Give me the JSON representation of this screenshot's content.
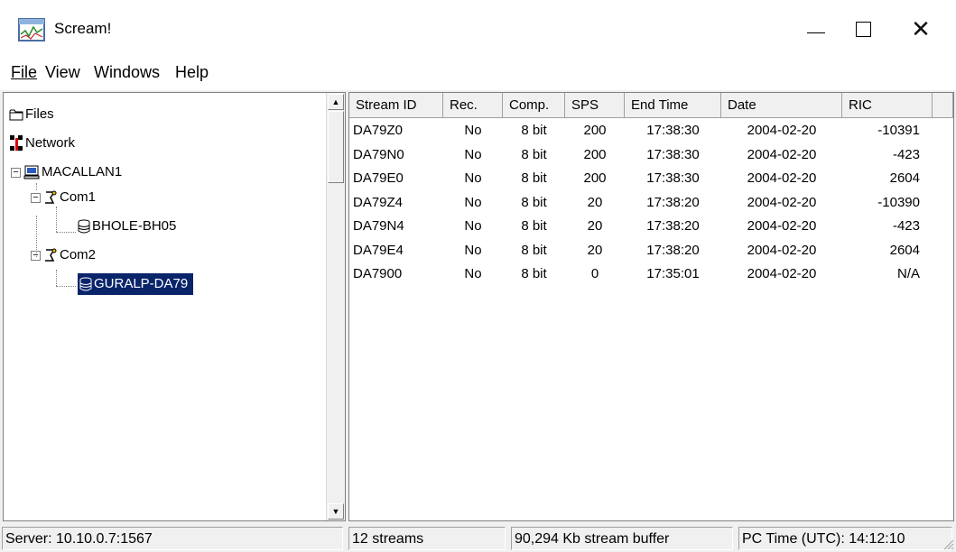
{
  "window": {
    "title": "Scream!"
  },
  "menu": [
    "File",
    "View",
    "Windows",
    "Help"
  ],
  "tree": {
    "files": "Files",
    "network": "Network",
    "server": "MACALLAN1",
    "com1": "Com1",
    "com1_device": "BHOLE-BH05",
    "com2": "Com2",
    "com2_device": "GURALP-DA79"
  },
  "columns": [
    "Stream ID",
    "Rec.",
    "Comp.",
    "SPS",
    "End Time",
    "Date",
    "RIC"
  ],
  "rows": [
    [
      "DA79Z0",
      "No",
      "8 bit",
      "200",
      "17:38:30",
      "2004-02-20",
      "-10391"
    ],
    [
      "DA79N0",
      "No",
      "8 bit",
      "200",
      "17:38:30",
      "2004-02-20",
      "-423"
    ],
    [
      "DA79E0",
      "No",
      "8 bit",
      "200",
      "17:38:30",
      "2004-02-20",
      "2604"
    ],
    [
      "DA79Z4",
      "No",
      "8 bit",
      "20",
      "17:38:20",
      "2004-02-20",
      "-10390"
    ],
    [
      "DA79N4",
      "No",
      "8 bit",
      "20",
      "17:38:20",
      "2004-02-20",
      "-423"
    ],
    [
      "DA79E4",
      "No",
      "8 bit",
      "20",
      "17:38:20",
      "2004-02-20",
      "2604"
    ],
    [
      "DA7900",
      "No",
      "8 bit",
      "0",
      "17:35:01",
      "2004-02-20",
      "N/A"
    ]
  ],
  "status": {
    "server": "Server: 10.10.0.7:1567",
    "streams": "12 streams",
    "buffer": "90,294 Kb stream buffer",
    "pctime": "PC Time (UTC):  14:12:10"
  },
  "icons": {
    "app": "scream-app-icon",
    "files": "folder-icon",
    "network": "network-icon",
    "server": "computer-icon",
    "com": "com-port-icon",
    "device": "database-icon"
  },
  "colors": {
    "selection": "#0a246a",
    "titlebar": "#ffffff",
    "face": "#f0f0f0"
  }
}
